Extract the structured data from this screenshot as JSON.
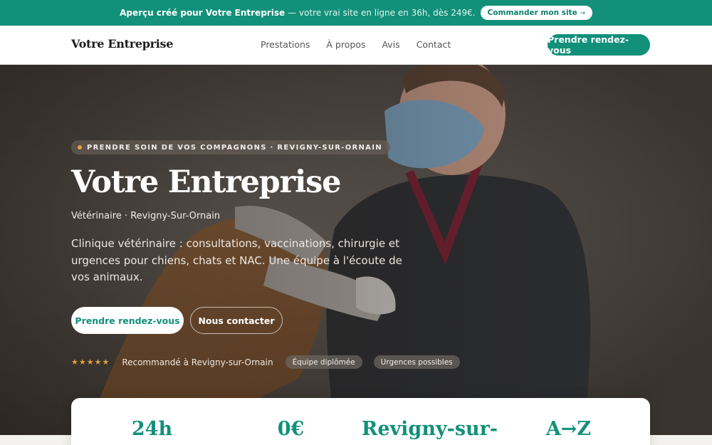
{
  "promo": {
    "lead": "Aperçu créé pour Votre Entreprise",
    "rest": "— votre vrai site en ligne en 36h, dès 249€.",
    "button": "Commander mon site",
    "button_arrow": "→"
  },
  "nav": {
    "brand": "Votre Entreprise",
    "links": [
      "Prestations",
      "À propos",
      "Avis",
      "Contact"
    ],
    "cta": "Prendre rendez-vous"
  },
  "hero": {
    "tagline": "PRENDRE SOIN DE VOS COMPAGNONS · REVIGNY-SUR-ORNAIN",
    "title": "Votre Entreprise",
    "subtitle": "Vétérinaire · Revigny-Sur-Ornain",
    "description": "Clinique vétérinaire : consultations, vaccinations, chirurgie et urgences pour chiens, chats et NAC. Une équipe à l'écoute de vos animaux.",
    "primary_button": "Prendre rendez-vous",
    "secondary_button": "Nous contacter",
    "rating_stars": "★★★★★",
    "rating": 5,
    "trust_text": "Recommandé à Revigny-sur-Ornain",
    "badges": [
      "Équipe diplômée",
      "Urgences possibles"
    ]
  },
  "stats": [
    "24h",
    "0€",
    "Revigny-sur-",
    "A→Z"
  ],
  "colors": {
    "accent": "#12907a",
    "star": "#e0a13a",
    "promo_bg": "#12907a"
  }
}
